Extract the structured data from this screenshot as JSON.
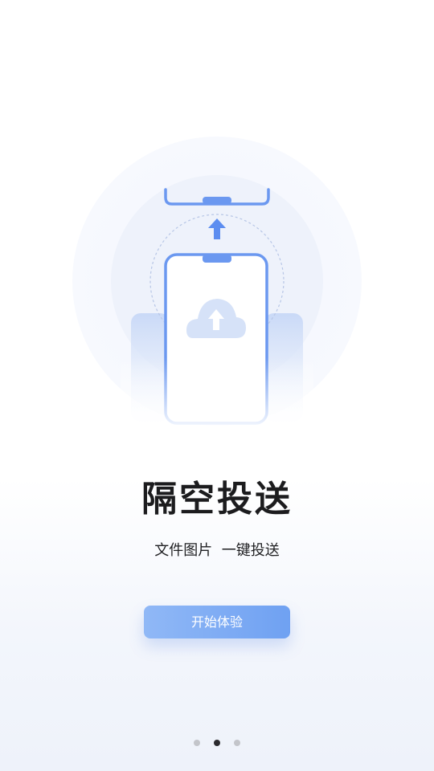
{
  "onboarding": {
    "title": "隔空投送",
    "subtitle": "文件图片  一键投送",
    "start_button_label": "开始体验",
    "page_count": 3,
    "active_page": 2
  },
  "colors": {
    "accent": "#6fa1f2",
    "phone_outline": "#5c8df0",
    "title_text": "#1c1c1e",
    "active_dot": "#2b2b2e",
    "inactive_dot": "#c3c5ca"
  },
  "icons": {
    "illustration": "phone-transfer-illustration",
    "upload_arrow": "arrow-up-icon",
    "cloud_upload": "cloud-upload-icon"
  }
}
